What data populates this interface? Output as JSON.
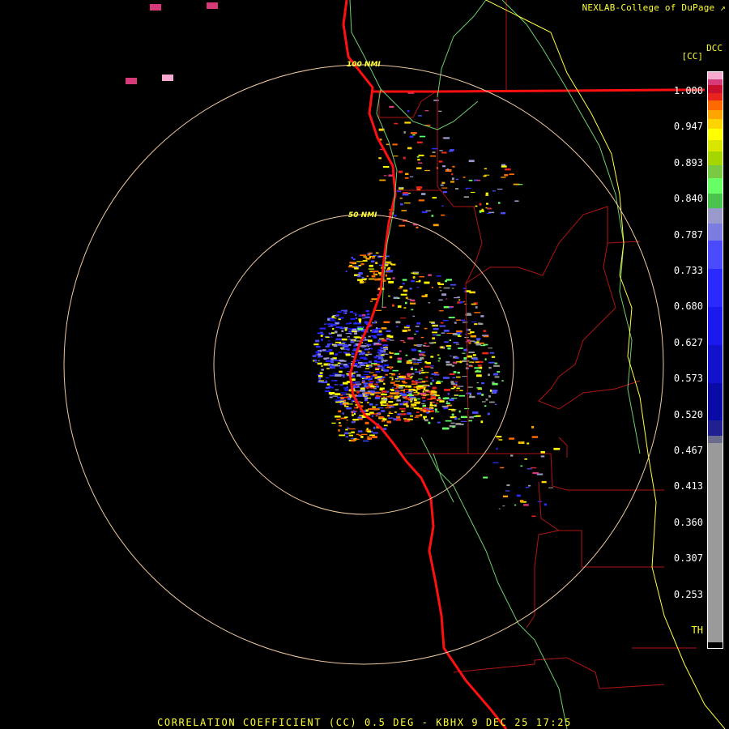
{
  "header": {
    "credit": "NEXLAB-College of DuPage",
    "credit_icon": "external-link-icon"
  },
  "legend": {
    "abbr": "DCC",
    "unit": "[CC]",
    "ticks": [
      "1.000",
      "0.947",
      "0.893",
      "0.840",
      "0.787",
      "0.733",
      "0.680",
      "0.627",
      "0.573",
      "0.520",
      "0.467",
      "0.413",
      "0.360",
      "0.307",
      "0.253",
      "TH"
    ],
    "colors": [
      "#f7a9d0",
      "#d73a78",
      "#c8102e",
      "#e8241c",
      "#ff6a00",
      "#ffa500",
      "#ffd400",
      "#ffff00",
      "#d8e600",
      "#a6d600",
      "#7ac943",
      "#66ff66",
      "#4cc34c",
      "#9999cc",
      "#7c7ce0",
      "#4a4aff",
      "#2a2aff",
      "#1a1aee",
      "#1212cc",
      "#0a0aa6",
      "#202090",
      "#6b6b8c",
      "#9a9a9a",
      "#9a9a9a",
      "#9a9a9a",
      "#000000"
    ],
    "colorbar_levels": [
      8,
      6,
      8,
      8,
      10,
      10,
      10,
      12,
      12,
      14,
      14,
      16,
      16,
      16,
      18,
      30,
      40,
      40,
      40,
      40,
      16,
      8,
      70,
      70,
      70,
      6
    ]
  },
  "map": {
    "range_rings": [
      {
        "label": "50 NMI"
      },
      {
        "label": "100 NMI"
      }
    ],
    "colors": {
      "ring": "#f0c8a0",
      "coast": "#ff1010",
      "state_border": "#ff1010",
      "county": "#b01414",
      "highway": "#6ecf6e",
      "other_border": "#ffff44"
    }
  },
  "footer": {
    "title": "CORRELATION COEFFICIENT (CC) 0.5 DEG - KBHX 9 DEC 25 17:25"
  }
}
